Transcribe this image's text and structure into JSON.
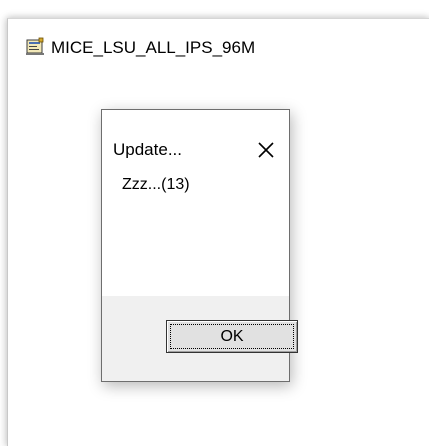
{
  "window": {
    "title": "MICE_LSU_ALL_IPS_96M",
    "icon": "application-window-icon"
  },
  "dialog": {
    "title": "Update...",
    "close_icon": "close-icon",
    "message": "Zzz...(13)",
    "ok_label": "OK"
  },
  "colors": {
    "window_background": "#ffffff",
    "dialog_footer": "#f0f0f0",
    "button_face": "#e1e1e1",
    "button_border": "#333333",
    "text": "#000000"
  }
}
